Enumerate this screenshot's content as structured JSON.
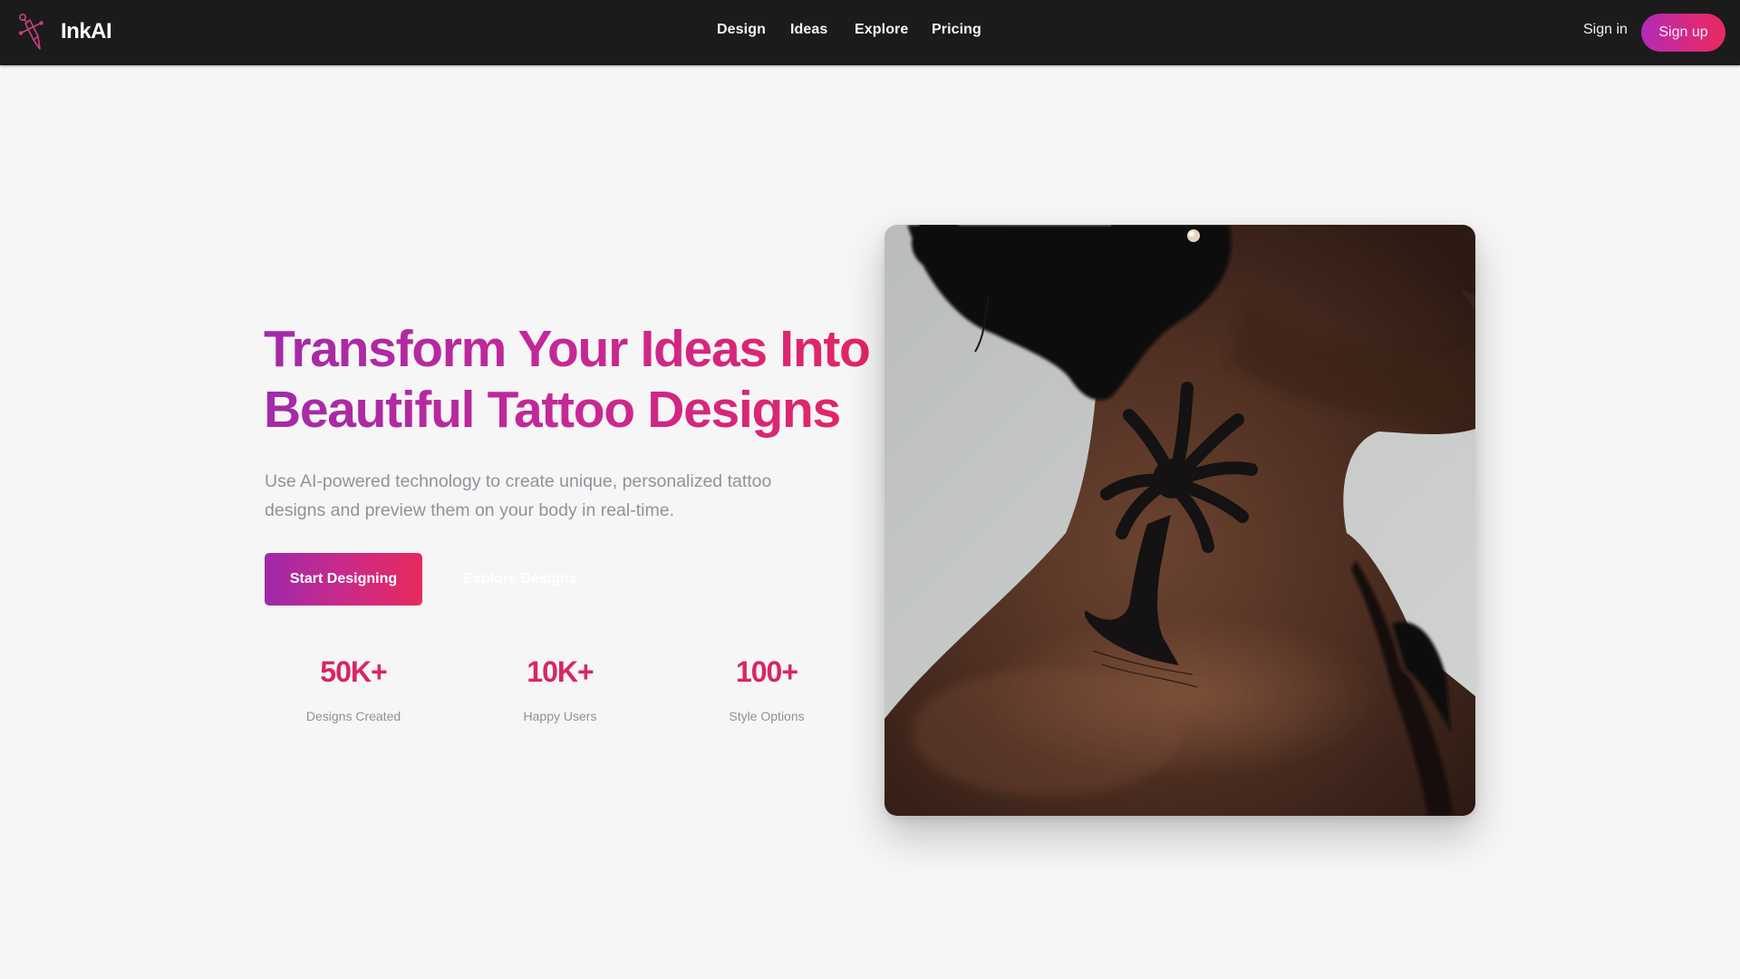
{
  "header": {
    "brand": "InkAI",
    "logo_icon": "tattoo-machine-icon",
    "nav": [
      {
        "label": "Design"
      },
      {
        "label": "Ideas"
      },
      {
        "label": "Explore"
      },
      {
        "label": "Pricing"
      }
    ],
    "sign_in": "Sign in",
    "sign_up": "Sign up"
  },
  "hero": {
    "title_line1": "Transform Your Ideas Into",
    "title_line2": "Beautiful Tattoo Designs",
    "subtitle": "Use AI-powered technology to create unique, personalized tattoo designs and preview them on your body in real-time.",
    "primary_cta": "Start Designing",
    "secondary_cta": "Explore Designs",
    "image_alt": "Woman with palm tree tattoo on her neck",
    "stats": [
      {
        "value": "50K+",
        "label": "Designs Created"
      },
      {
        "value": "10K+",
        "label": "Happy Users"
      },
      {
        "value": "100+",
        "label": "Style Options"
      }
    ]
  },
  "colors": {
    "header_bg": "#1b1b1b",
    "page_bg": "#f6f6f6",
    "gradient_start": "#a22aa8",
    "gradient_end": "#e7255d",
    "stat_value": "#d8275e",
    "muted_text": "#8e939c"
  }
}
